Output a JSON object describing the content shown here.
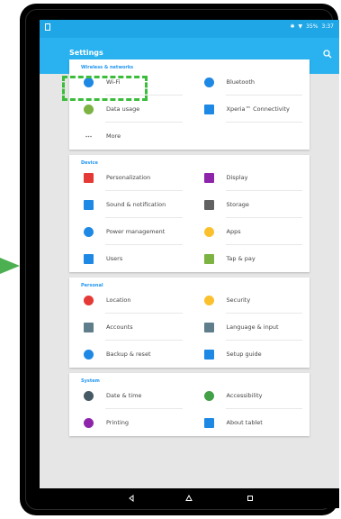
{
  "status": {
    "battery": "35%",
    "time": "3:37"
  },
  "header": {
    "title": "Settings"
  },
  "sections": [
    {
      "title": "Wireless & networks",
      "rows": [
        [
          {
            "label": "Wi-Fi",
            "icon": "wifi-icon",
            "color": "#1e88e5"
          },
          {
            "label": "Bluetooth",
            "icon": "bluetooth-icon",
            "color": "#1e88e5"
          }
        ],
        [
          {
            "label": "Data usage",
            "icon": "data-usage-icon",
            "color": "#7cb342"
          },
          {
            "label": "Xperia™ Connectivity",
            "icon": "xperia-connectivity-icon",
            "color": "#1e88e5"
          }
        ],
        [
          {
            "label": "More",
            "icon": "more-icon",
            "color": "#9e9e9e"
          }
        ]
      ]
    },
    {
      "title": "Device",
      "rows": [
        [
          {
            "label": "Personalization",
            "icon": "personalization-icon",
            "color": "#e53935"
          },
          {
            "label": "Display",
            "icon": "display-icon",
            "color": "#8e24aa"
          }
        ],
        [
          {
            "label": "Sound & notification",
            "icon": "sound-icon",
            "color": "#1e88e5"
          },
          {
            "label": "Storage",
            "icon": "storage-icon",
            "color": "#616161"
          }
        ],
        [
          {
            "label": "Power management",
            "icon": "power-icon",
            "color": "#1e88e5"
          },
          {
            "label": "Apps",
            "icon": "apps-icon",
            "color": "#fbc02d"
          }
        ],
        [
          {
            "label": "Users",
            "icon": "users-icon",
            "color": "#1e88e5"
          },
          {
            "label": "Tap & pay",
            "icon": "tap-pay-icon",
            "color": "#7cb342"
          }
        ]
      ]
    },
    {
      "title": "Personal",
      "rows": [
        [
          {
            "label": "Location",
            "icon": "location-icon",
            "color": "#e53935"
          },
          {
            "label": "Security",
            "icon": "security-icon",
            "color": "#fbc02d"
          }
        ],
        [
          {
            "label": "Accounts",
            "icon": "accounts-icon",
            "color": "#607d8b"
          },
          {
            "label": "Language & input",
            "icon": "keyboard-icon",
            "color": "#607d8b"
          }
        ],
        [
          {
            "label": "Backup & reset",
            "icon": "backup-icon",
            "color": "#1e88e5"
          },
          {
            "label": "Setup guide",
            "icon": "setup-guide-icon",
            "color": "#1e88e5"
          }
        ]
      ]
    },
    {
      "title": "System",
      "rows": [
        [
          {
            "label": "Date & time",
            "icon": "clock-icon",
            "color": "#455a64"
          },
          {
            "label": "Accessibility",
            "icon": "accessibility-icon",
            "color": "#43a047"
          }
        ],
        [
          {
            "label": "Printing",
            "icon": "printing-icon",
            "color": "#8e24aa"
          },
          {
            "label": "About tablet",
            "icon": "about-tablet-icon",
            "color": "#1e88e5"
          }
        ]
      ]
    }
  ]
}
